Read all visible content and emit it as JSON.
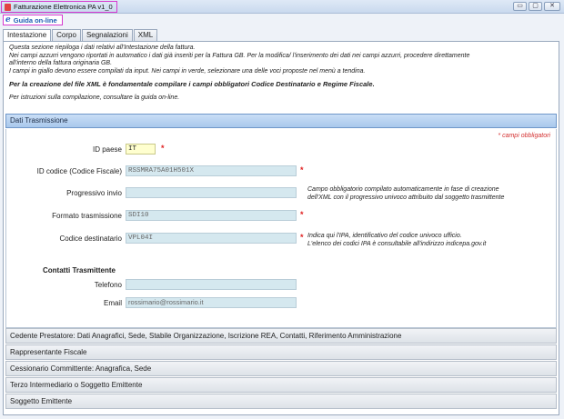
{
  "window": {
    "title": "Fatturazione Elettronica PA v1_0",
    "controls": [
      "▭",
      "▢",
      "✕"
    ]
  },
  "toolbar": {
    "guida_label": "Guida on-line",
    "guida_icon": "e"
  },
  "tabs": [
    {
      "label": "Intestazione",
      "active": true
    },
    {
      "label": "Corpo",
      "active": false
    },
    {
      "label": "Segnalazioni",
      "active": false
    },
    {
      "label": "XML",
      "active": false
    }
  ],
  "intro": {
    "line1": "Questa sezione riepiloga i dati relativi all'Intestazione della fattura.",
    "line2": "Nei campi azzurri vengono riportati in automatico i dati già inseriti per la Fattura GB. Per la modifica/ l'inserimento dei dati nei campi azzurri, procedere direttamente",
    "line3": "all'interno della fattura originaria GB.",
    "line4": "I campi in giallo devono essere compilati da input. Nei campi in verde, selezionare una delle voci proposte nel menù a tendina.",
    "bold_line": "Per la creazione del file XML è fondamentale compilare i campi obbligatori Codice Destinatario e Regime Fiscale.",
    "guide_line": "Per istruzioni sulla compilazione, consultare la guida on-line."
  },
  "dati_trasmissione": {
    "header": "Dati Trasmissione",
    "required_note": "* campi obbligatori",
    "id_paese_label": "ID paese",
    "id_paese_value": "IT",
    "id_codice_label": "ID codice (Codice Fiscale)",
    "id_codice_value": "RSSMRA75A01H501X",
    "progressivo_label": "Progressivo invio",
    "progressivo_value": "",
    "progressivo_help_1": "Campo obbligatorio compilato automaticamente in fase di creazione",
    "progressivo_help_2": "dell'XML con il progressivo univoco attribuito dal soggetto trasmittente",
    "formato_label": "Formato trasmissione",
    "formato_value": "SDI10",
    "codice_dest_label": "Codice destinatario",
    "codice_dest_value": "VPL04I",
    "codice_dest_help_1": "Indica qui l'IPA, identificativo del codice univoco ufficio.",
    "codice_dest_help_2": "L'elenco dei codici IPA è consultabile all'indirizzo indicepa.gov.it",
    "contatti_header": "Contatti Trasmittente",
    "telefono_label": "Telefono",
    "telefono_value": "",
    "email_label": "Email",
    "email_value": "rossimario@rossimario.it",
    "star": "*"
  },
  "accordions": [
    "Cedente Prestatore: Dati Anagrafici, Sede, Stabile Organizzazione, Iscrizione REA, Contatti, Riferimento Amministrazione",
    "Rappresentante Fiscale",
    "Cessionario Committente: Anagrafica, Sede",
    "Terzo Intermediario o Soggetto Emittente",
    "Soggetto Emittente"
  ],
  "colors": {
    "blue_field": "#d5e8ef",
    "yellow_field": "#ffffcf",
    "required_red": "#e02020",
    "section_header": "#b8d3f1"
  }
}
